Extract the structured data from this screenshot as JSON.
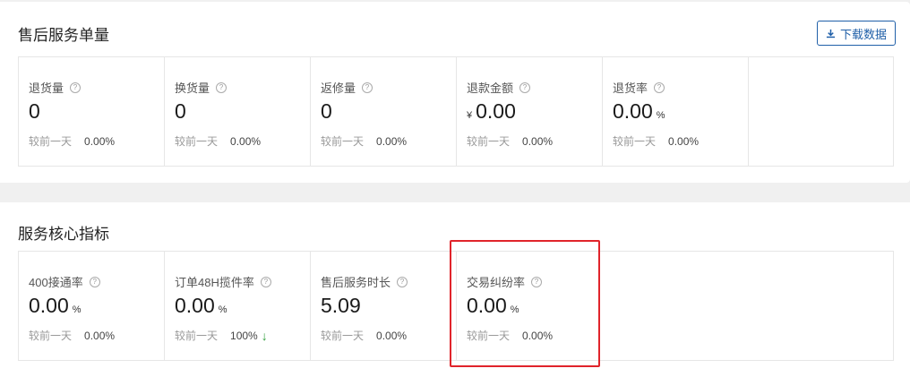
{
  "panel1": {
    "title": "售后服务单量",
    "download_label": "下载数据",
    "metrics": [
      {
        "label": "退货量",
        "value": "0",
        "prefix": "",
        "unit": "",
        "compare_label": "较前一天",
        "compare_value": "0.00%"
      },
      {
        "label": "换货量",
        "value": "0",
        "prefix": "",
        "unit": "",
        "compare_label": "较前一天",
        "compare_value": "0.00%"
      },
      {
        "label": "返修量",
        "value": "0",
        "prefix": "",
        "unit": "",
        "compare_label": "较前一天",
        "compare_value": "0.00%"
      },
      {
        "label": "退款金额",
        "value": "0.00",
        "prefix": "¥",
        "unit": "",
        "compare_label": "较前一天",
        "compare_value": "0.00%"
      },
      {
        "label": "退货率",
        "value": "0.00",
        "prefix": "",
        "unit": "%",
        "compare_label": "较前一天",
        "compare_value": "0.00%"
      }
    ]
  },
  "panel2": {
    "title": "服务核心指标",
    "metrics": [
      {
        "label": "400接通率",
        "value": "0.00",
        "unit": "%",
        "compare_label": "较前一天",
        "compare_value": "0.00%"
      },
      {
        "label": "订单48H揽件率",
        "value": "0.00",
        "unit": "%",
        "compare_label": "较前一天",
        "compare_value": "100%",
        "trend": "down"
      },
      {
        "label": "售后服务时长",
        "value": "5.09",
        "unit": "",
        "compare_label": "较前一天",
        "compare_value": "0.00%"
      },
      {
        "label": "交易纠纷率",
        "value": "0.00",
        "unit": "%",
        "compare_label": "较前一天",
        "compare_value": "0.00%"
      }
    ]
  },
  "help_glyph": "?",
  "trend_glyph": "↓",
  "colors": {
    "accent": "#1f5fa8",
    "highlight": "#e0242b",
    "trend_down": "#2e9d3a"
  }
}
